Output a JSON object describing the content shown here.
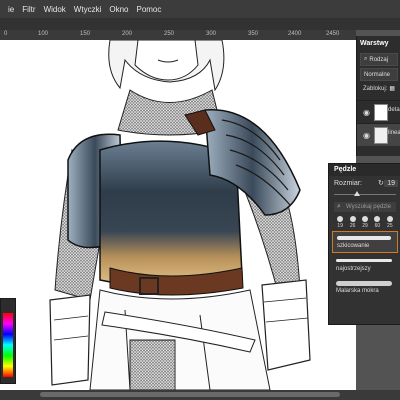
{
  "menu": {
    "items": [
      "ie",
      "Filtr",
      "Widok",
      "Wtyczki",
      "Okno",
      "Pomoc"
    ]
  },
  "ruler": {
    "ticks": [
      "0",
      "100",
      "150",
      "200",
      "250",
      "300",
      "350",
      "2400",
      "2450"
    ]
  },
  "layers": {
    "tab_label": "Warstwy",
    "filter_label": "Rodzaj",
    "blend_mode": "Normalne",
    "lock_label": "Zablokuj:",
    "rows": [
      {
        "name": "detal"
      },
      {
        "name": "lineart"
      }
    ]
  },
  "brushes": {
    "title": "Pędzle",
    "size_label": "Rozmiar:",
    "size_value": "19",
    "search_placeholder": "Wyszukaj pędzle",
    "tip_sizes": [
      "19",
      "26",
      "29",
      "60",
      "25"
    ],
    "items": [
      {
        "name": "szkicowanie",
        "selected": true
      },
      {
        "name": "najostrzejszy",
        "selected": false
      },
      {
        "name": "Malarska mokra",
        "selected": false
      }
    ],
    "accent_color": "#d07b2c"
  },
  "icons": [
    "search-icon",
    "eye-icon",
    "refresh-icon",
    "link-icon",
    "lock-icon"
  ]
}
